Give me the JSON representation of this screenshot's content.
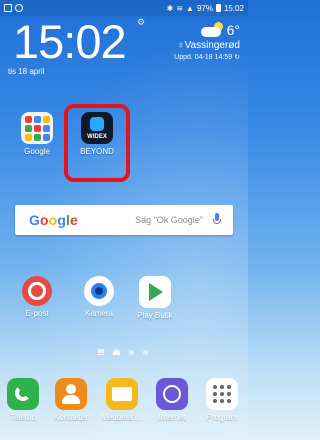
{
  "statusbar": {
    "left_icons": [
      "image-icon",
      "notification-icon"
    ],
    "battery": "97%",
    "time": "15:02"
  },
  "clock": {
    "time": "15:02",
    "date": "tis 18 april"
  },
  "weather": {
    "temp": "6°",
    "location": "♀Vassingerød",
    "updated": "Uppd. 04-18 14:59"
  },
  "home_apps": [
    {
      "label": "Google",
      "icon": "google-folder-icon"
    },
    {
      "label": "BEYOND",
      "icon": "widex-beyond-icon",
      "icon_text": "WIDEX",
      "highlighted": true
    }
  ],
  "search": {
    "logo": "Google",
    "hint": "Säg \"Ok Google\""
  },
  "row_apps": [
    {
      "label": "E-post",
      "icon": "email-icon"
    },
    {
      "label": "Kamera",
      "icon": "camera-icon"
    },
    {
      "label": "Play Butik",
      "icon": "play-store-icon"
    }
  ],
  "dock": [
    {
      "label": "Telefon",
      "icon": "phone-icon",
      "color": "#2fb24c"
    },
    {
      "label": "Kontakter",
      "icon": "contacts-icon",
      "color": "#f08b1a"
    },
    {
      "label": "Meddelan...",
      "icon": "messages-icon",
      "color": "#f6b81b"
    },
    {
      "label": "Internet",
      "icon": "internet-icon",
      "color": "#6a58d6"
    },
    {
      "label": "Program",
      "icon": "apps-icon",
      "color": "#ffffff"
    }
  ],
  "colors": {
    "highlight": "#e4141a",
    "email": "#e54b45",
    "camera": "#2d7ff0"
  }
}
